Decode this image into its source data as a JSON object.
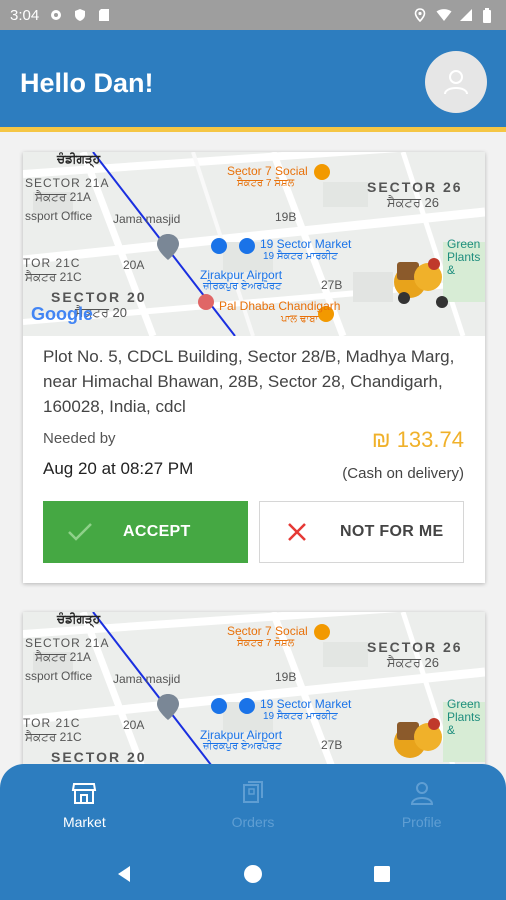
{
  "status_bar": {
    "time": "3:04"
  },
  "header": {
    "greeting": "Hello Dan!"
  },
  "orders": [
    {
      "map_labels": {
        "chandigarh": "ਚੰਡੀਗੜ੍ਹ",
        "sector21a": "SECTOR 21A",
        "sector21a_pa": "ਸੈਕਟਰ 21A",
        "passport": "ssport Office",
        "jama_masjid": "Jama masjid",
        "sector7_social": "Sector 7 Social",
        "sector7_social_pa": "ਸੈਕਟਰ 7 ਸੋਸ਼ਲ",
        "sector26": "SECTOR 26",
        "sector26_pa": "ਸੈਕਟਰ 26",
        "n19b": "19B",
        "sector_market": "19 Sector Market",
        "sector_market_pa": "19 ਸੈਕਟਰ ਮਾਰਕੀਟ",
        "green_plants": "Green Plants &",
        "sector21c": "TOR 21C",
        "sector21c_pa": "ਸੈਕਟਰ 21C",
        "n20a": "20A",
        "zirakpur": "Zirakpur Airport",
        "zirakpur_pa": "ਜ਼ੀਰਕਪੁਰ ਏਅਰਪੋਰਟ",
        "n27b": "27B",
        "sector20": "SECTOR 20",
        "sector20_pa": "ਸੈਕਟਰ 20",
        "pal_dhaba": "Pal Dhaba Chandigarh",
        "pal_dhaba_pa": "ਪਾਲ ਢਾਬਾ",
        "google": "Google"
      },
      "address": "Plot No. 5, CDCL Building, Sector 28/B, Madhya Marg, near Himachal Bhawan, 28B, Sector 28, Chandigarh, 160028, India, cdcl",
      "needed_label": "Needed by",
      "needed_date": "Aug 20 at 08:27 PM",
      "price": "₪ 133.74",
      "payment_note": "(Cash on delivery)",
      "accept_label": "ACCEPT",
      "reject_label": "NOT FOR ME"
    }
  ],
  "bottom_nav": [
    {
      "label": "Market",
      "icon": "market-icon",
      "active": true
    },
    {
      "label": "Orders",
      "icon": "orders-icon",
      "active": false
    },
    {
      "label": "Profile",
      "icon": "profile-icon",
      "active": false
    }
  ],
  "colors": {
    "primary": "#2d7dbf",
    "accent_yellow": "#f5c645",
    "accept_green": "#45a843",
    "price": "#f0b12a",
    "reject_x": "#e53935"
  }
}
